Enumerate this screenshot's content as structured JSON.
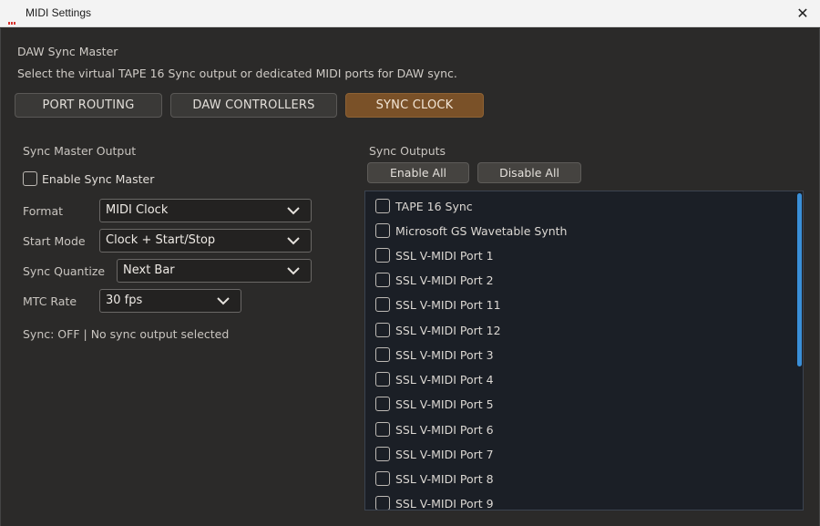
{
  "window": {
    "title": "MIDI Settings",
    "close_glyph": "✕"
  },
  "header": {
    "section_title": "DAW Sync Master",
    "description": "Select the virtual TAPE 16 Sync output or dedicated MIDI ports for DAW sync."
  },
  "tabs": [
    {
      "label": "PORT ROUTING",
      "active": false
    },
    {
      "label": "DAW CONTROLLERS",
      "active": false
    },
    {
      "label": "SYNC CLOCK",
      "active": true
    }
  ],
  "left": {
    "title": "Sync Master Output",
    "enable_label": "Enable Sync Master",
    "fields": [
      {
        "label": "Format",
        "value": "MIDI Clock"
      },
      {
        "label": "Start Mode",
        "value": "Clock + Start/Stop"
      },
      {
        "label": "Sync Quantize",
        "value": "Next Bar"
      },
      {
        "label": "MTC Rate",
        "value": "30 fps"
      }
    ],
    "status": "Sync: OFF | No sync output selected"
  },
  "right": {
    "title": "Sync Outputs",
    "enable_all": "Enable All",
    "disable_all": "Disable All",
    "outputs": [
      "TAPE 16 Sync",
      "Microsoft GS Wavetable Synth",
      "SSL V-MIDI Port 1",
      "SSL V-MIDI Port 2",
      "SSL V-MIDI Port 11",
      "SSL V-MIDI Port 12",
      "SSL V-MIDI Port 3",
      "SSL V-MIDI Port 4",
      "SSL V-MIDI Port 5",
      "SSL V-MIDI Port 6",
      "SSL V-MIDI Port 7",
      "SSL V-MIDI Port 8",
      "SSL V-MIDI Port 9"
    ]
  },
  "colors": {
    "accent_active_tab": "#7a5128",
    "scrollbar": "#3a8fd8",
    "background": "#2b2a29"
  },
  "icons": {
    "app": "app-logo-icon",
    "close": "close-icon",
    "dropdown": "chevron-down-icon",
    "checkbox": "checkbox-unchecked-icon"
  }
}
